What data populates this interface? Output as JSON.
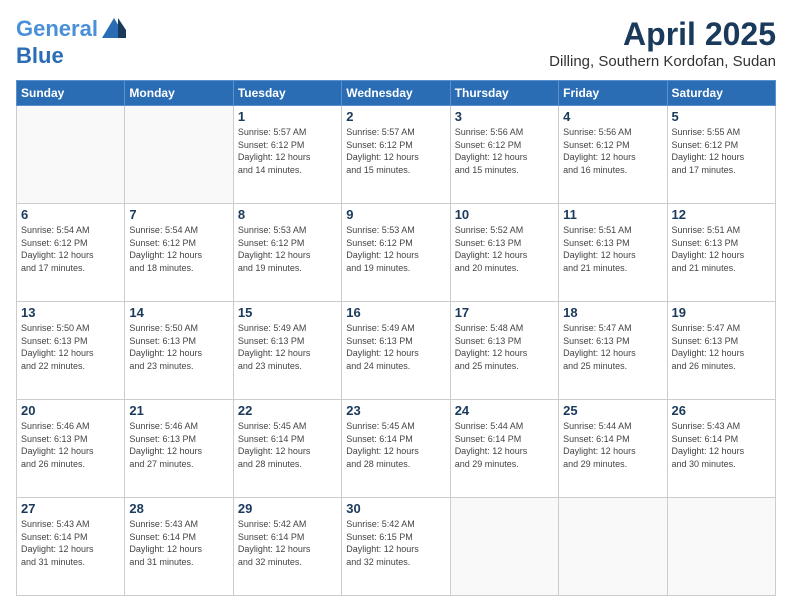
{
  "header": {
    "logo_line1": "General",
    "logo_line2": "Blue",
    "title": "April 2025",
    "subtitle": "Dilling, Southern Kordofan, Sudan"
  },
  "weekdays": [
    "Sunday",
    "Monday",
    "Tuesday",
    "Wednesday",
    "Thursday",
    "Friday",
    "Saturday"
  ],
  "weeks": [
    [
      {
        "day": "",
        "info": ""
      },
      {
        "day": "",
        "info": ""
      },
      {
        "day": "1",
        "info": "Sunrise: 5:57 AM\nSunset: 6:12 PM\nDaylight: 12 hours\nand 14 minutes."
      },
      {
        "day": "2",
        "info": "Sunrise: 5:57 AM\nSunset: 6:12 PM\nDaylight: 12 hours\nand 15 minutes."
      },
      {
        "day": "3",
        "info": "Sunrise: 5:56 AM\nSunset: 6:12 PM\nDaylight: 12 hours\nand 15 minutes."
      },
      {
        "day": "4",
        "info": "Sunrise: 5:56 AM\nSunset: 6:12 PM\nDaylight: 12 hours\nand 16 minutes."
      },
      {
        "day": "5",
        "info": "Sunrise: 5:55 AM\nSunset: 6:12 PM\nDaylight: 12 hours\nand 17 minutes."
      }
    ],
    [
      {
        "day": "6",
        "info": "Sunrise: 5:54 AM\nSunset: 6:12 PM\nDaylight: 12 hours\nand 17 minutes."
      },
      {
        "day": "7",
        "info": "Sunrise: 5:54 AM\nSunset: 6:12 PM\nDaylight: 12 hours\nand 18 minutes."
      },
      {
        "day": "8",
        "info": "Sunrise: 5:53 AM\nSunset: 6:12 PM\nDaylight: 12 hours\nand 19 minutes."
      },
      {
        "day": "9",
        "info": "Sunrise: 5:53 AM\nSunset: 6:12 PM\nDaylight: 12 hours\nand 19 minutes."
      },
      {
        "day": "10",
        "info": "Sunrise: 5:52 AM\nSunset: 6:13 PM\nDaylight: 12 hours\nand 20 minutes."
      },
      {
        "day": "11",
        "info": "Sunrise: 5:51 AM\nSunset: 6:13 PM\nDaylight: 12 hours\nand 21 minutes."
      },
      {
        "day": "12",
        "info": "Sunrise: 5:51 AM\nSunset: 6:13 PM\nDaylight: 12 hours\nand 21 minutes."
      }
    ],
    [
      {
        "day": "13",
        "info": "Sunrise: 5:50 AM\nSunset: 6:13 PM\nDaylight: 12 hours\nand 22 minutes."
      },
      {
        "day": "14",
        "info": "Sunrise: 5:50 AM\nSunset: 6:13 PM\nDaylight: 12 hours\nand 23 minutes."
      },
      {
        "day": "15",
        "info": "Sunrise: 5:49 AM\nSunset: 6:13 PM\nDaylight: 12 hours\nand 23 minutes."
      },
      {
        "day": "16",
        "info": "Sunrise: 5:49 AM\nSunset: 6:13 PM\nDaylight: 12 hours\nand 24 minutes."
      },
      {
        "day": "17",
        "info": "Sunrise: 5:48 AM\nSunset: 6:13 PM\nDaylight: 12 hours\nand 25 minutes."
      },
      {
        "day": "18",
        "info": "Sunrise: 5:47 AM\nSunset: 6:13 PM\nDaylight: 12 hours\nand 25 minutes."
      },
      {
        "day": "19",
        "info": "Sunrise: 5:47 AM\nSunset: 6:13 PM\nDaylight: 12 hours\nand 26 minutes."
      }
    ],
    [
      {
        "day": "20",
        "info": "Sunrise: 5:46 AM\nSunset: 6:13 PM\nDaylight: 12 hours\nand 26 minutes."
      },
      {
        "day": "21",
        "info": "Sunrise: 5:46 AM\nSunset: 6:13 PM\nDaylight: 12 hours\nand 27 minutes."
      },
      {
        "day": "22",
        "info": "Sunrise: 5:45 AM\nSunset: 6:14 PM\nDaylight: 12 hours\nand 28 minutes."
      },
      {
        "day": "23",
        "info": "Sunrise: 5:45 AM\nSunset: 6:14 PM\nDaylight: 12 hours\nand 28 minutes."
      },
      {
        "day": "24",
        "info": "Sunrise: 5:44 AM\nSunset: 6:14 PM\nDaylight: 12 hours\nand 29 minutes."
      },
      {
        "day": "25",
        "info": "Sunrise: 5:44 AM\nSunset: 6:14 PM\nDaylight: 12 hours\nand 29 minutes."
      },
      {
        "day": "26",
        "info": "Sunrise: 5:43 AM\nSunset: 6:14 PM\nDaylight: 12 hours\nand 30 minutes."
      }
    ],
    [
      {
        "day": "27",
        "info": "Sunrise: 5:43 AM\nSunset: 6:14 PM\nDaylight: 12 hours\nand 31 minutes."
      },
      {
        "day": "28",
        "info": "Sunrise: 5:43 AM\nSunset: 6:14 PM\nDaylight: 12 hours\nand 31 minutes."
      },
      {
        "day": "29",
        "info": "Sunrise: 5:42 AM\nSunset: 6:14 PM\nDaylight: 12 hours\nand 32 minutes."
      },
      {
        "day": "30",
        "info": "Sunrise: 5:42 AM\nSunset: 6:15 PM\nDaylight: 12 hours\nand 32 minutes."
      },
      {
        "day": "",
        "info": ""
      },
      {
        "day": "",
        "info": ""
      },
      {
        "day": "",
        "info": ""
      }
    ]
  ]
}
